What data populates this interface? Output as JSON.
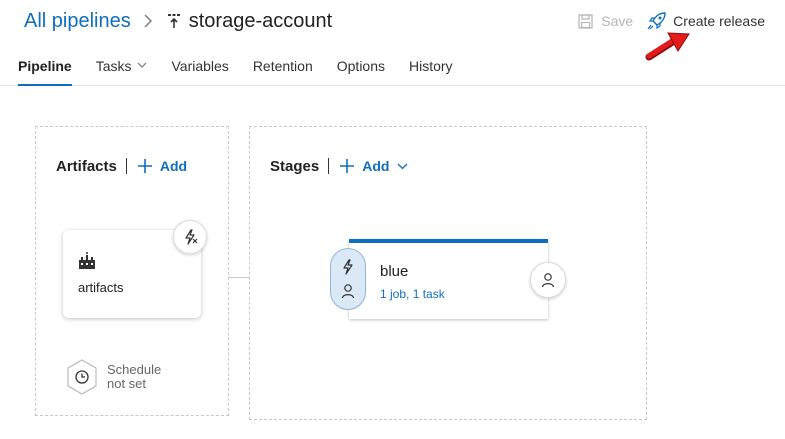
{
  "header": {
    "breadcrumb_root": "All pipelines",
    "title": "storage-account",
    "save_label": "Save",
    "create_release_label": "Create release"
  },
  "tabs": [
    {
      "label": "Pipeline",
      "active": true
    },
    {
      "label": "Tasks",
      "has_dropdown": true
    },
    {
      "label": "Variables"
    },
    {
      "label": "Retention"
    },
    {
      "label": "Options"
    },
    {
      "label": "History"
    }
  ],
  "artifacts": {
    "title": "Artifacts",
    "add_label": "Add",
    "items": [
      {
        "name": "artifacts",
        "icon": "build-icon"
      }
    ],
    "schedule_label_line1": "Schedule",
    "schedule_label_line2": "not set"
  },
  "stages": {
    "title": "Stages",
    "add_label": "Add",
    "items": [
      {
        "name": "blue",
        "summary": "1 job, 1 task"
      }
    ]
  },
  "colors": {
    "accent": "#106ebe",
    "annotation_arrow": "#e41b1b",
    "stage_pill_bg": "#dbe9f7"
  }
}
